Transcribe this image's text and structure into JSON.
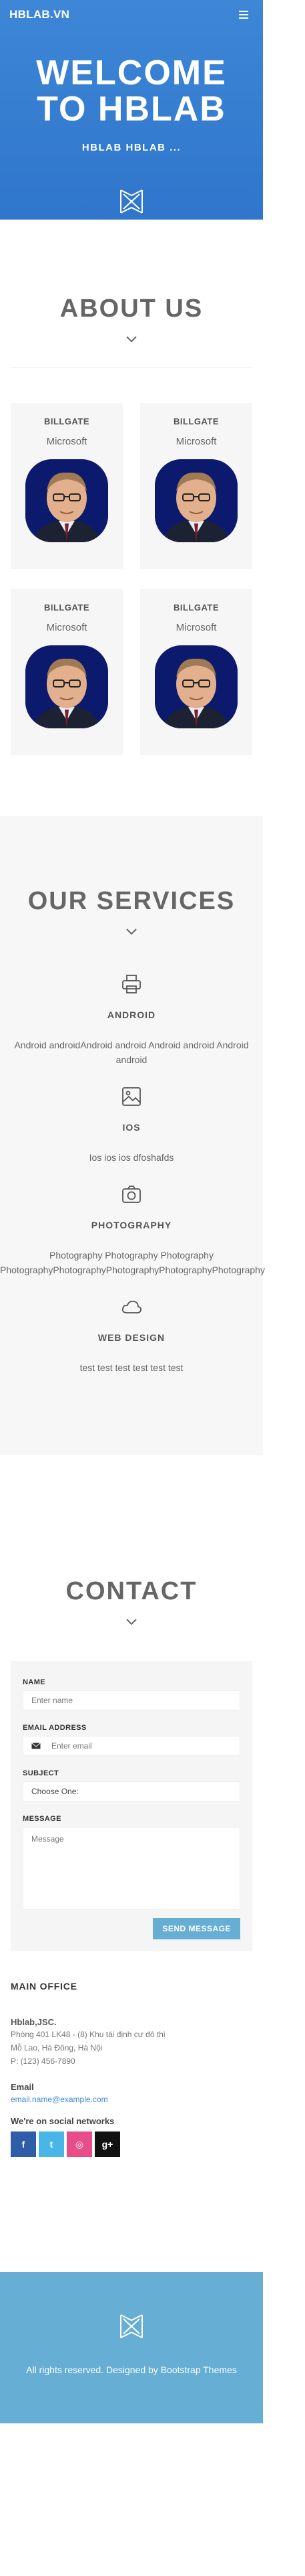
{
  "header": {
    "brand": "HBLAB.VN",
    "menu_icon": "hamburger-icon",
    "hero_title_line1": "WELCOME",
    "hero_title_line2": "TO HBLAB",
    "hero_subtitle": "HBLAB HBLAB ...",
    "logo_icon": "hblab-logo-icon"
  },
  "about": {
    "title": "ABOUT US",
    "members": [
      {
        "name": "BILLGATE",
        "company": "Microsoft"
      },
      {
        "name": "BILLGATE",
        "company": "Microsoft"
      },
      {
        "name": "BILLGATE",
        "company": "Microsoft"
      },
      {
        "name": "BILLGATE",
        "company": "Microsoft"
      }
    ]
  },
  "services": {
    "title": "OUR SERVICES",
    "items": [
      {
        "icon": "printer-icon",
        "title": "ANDROID",
        "desc": "Android androidAndroid android Android android Android android"
      },
      {
        "icon": "image-icon",
        "title": "IOS",
        "desc": "Ios ios ios dfoshafds"
      },
      {
        "icon": "camera-icon",
        "title": "PHOTOGRAPHY",
        "desc": "Photography Photography Photography PhotographyPhotographyPhotographyPhotographyPhotography"
      },
      {
        "icon": "cloud-icon",
        "title": "WEB DESIGN",
        "desc": "test test test test test test"
      }
    ]
  },
  "contact": {
    "title": "CONTACT",
    "form": {
      "name_label": "NAME",
      "name_placeholder": "Enter name",
      "email_label": "EMAIL ADDRESS",
      "email_placeholder": "Enter email",
      "subject_label": "SUBJECT",
      "subject_value": "Choose One:",
      "message_label": "MESSAGE",
      "message_placeholder": "Message",
      "send_label": "SEND MESSAGE"
    },
    "office": {
      "heading": "MAIN OFFICE",
      "org": "Hblab,JSC.",
      "addr1": "Phòng 401 LK48 - (8) Khu tái định cư đô thị",
      "addr2": "Mỗ Lao, Hà Đông, Hà Nội",
      "phone": "P: (123) 456-7890",
      "email_heading": "Email",
      "email": "email.name@example.com",
      "social_heading": "We're on social networks",
      "social": [
        {
          "icon": "facebook-icon",
          "glyph": "f"
        },
        {
          "icon": "twitter-icon",
          "glyph": "t"
        },
        {
          "icon": "dribbble-icon",
          "glyph": "◎"
        },
        {
          "icon": "google-plus-icon",
          "glyph": "g+"
        }
      ]
    }
  },
  "footer": {
    "logo_icon": "hblab-logo-icon",
    "copyright": "All rights reserved. Designed by Bootstrap Themes"
  },
  "colors": {
    "hero_blue": "#3e86d6",
    "footer_blue": "#67aed4",
    "facebook": "#2e5ea8",
    "twitter": "#49b6e8",
    "dribbble": "#e84c89",
    "googleplus": "#111111"
  }
}
